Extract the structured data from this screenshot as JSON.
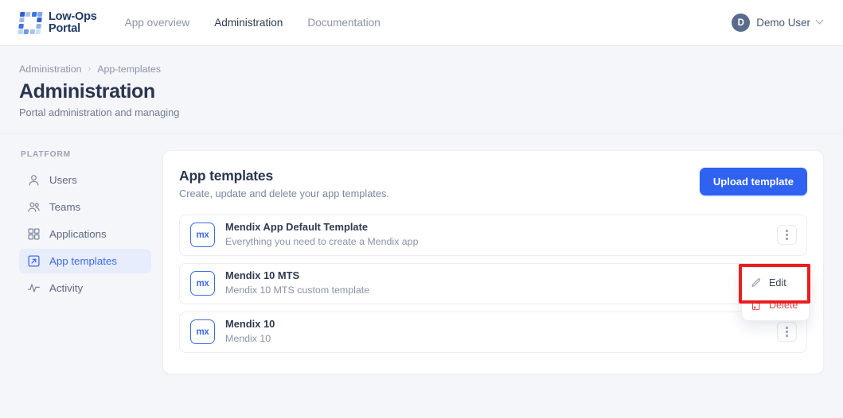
{
  "nav": {
    "brand_line1": "Low-Ops",
    "brand_line2": "Portal",
    "links": [
      {
        "label": "App overview",
        "active": false
      },
      {
        "label": "Administration",
        "active": true
      },
      {
        "label": "Documentation",
        "active": false
      }
    ],
    "user": {
      "initial": "D",
      "name": "Demo User",
      "chevron_icon": "chevron-down-icon"
    }
  },
  "page": {
    "breadcrumb": [
      "Administration",
      "App-templates"
    ],
    "breadcrumb_separator": "›",
    "title": "Administration",
    "subtitle": "Portal administration and managing"
  },
  "sidebar": {
    "section_label": "PLATFORM",
    "items": [
      {
        "label": "Users",
        "icon": "user-icon",
        "active": false
      },
      {
        "label": "Teams",
        "icon": "users-icon",
        "active": false
      },
      {
        "label": "Applications",
        "icon": "grid-icon",
        "active": false
      },
      {
        "label": "App templates",
        "icon": "template-icon",
        "active": true
      },
      {
        "label": "Activity",
        "icon": "activity-icon",
        "active": false
      }
    ]
  },
  "card": {
    "title": "App templates",
    "subtitle": "Create, update and delete your app templates.",
    "upload_button": "Upload template",
    "templates": [
      {
        "badge": "mx",
        "name": "Mendix App Default Template",
        "description": "Everything you need to create a Mendix app",
        "menu_icon": "kebab-menu-icon"
      },
      {
        "badge": "mx",
        "name": "Mendix 10 MTS",
        "description": "Mendix 10 MTS custom template",
        "menu_icon": "kebab-menu-icon"
      },
      {
        "badge": "mx",
        "name": "Mendix 10",
        "description": "Mendix 10",
        "menu_icon": "kebab-menu-icon"
      }
    ]
  },
  "context_menu": {
    "items": [
      {
        "label": "Edit",
        "icon": "pencil-icon",
        "variant": "edit"
      },
      {
        "label": "Delete",
        "icon": "trash-icon",
        "variant": "delete"
      }
    ]
  },
  "colors": {
    "accent": "#2f62f0",
    "brand_blue": "#3d6ae8",
    "page_bg": "#f5f6fa",
    "danger": "#d94a4a",
    "highlight": "#e81f1f",
    "sidebar_active_bg": "#e8edfd"
  }
}
